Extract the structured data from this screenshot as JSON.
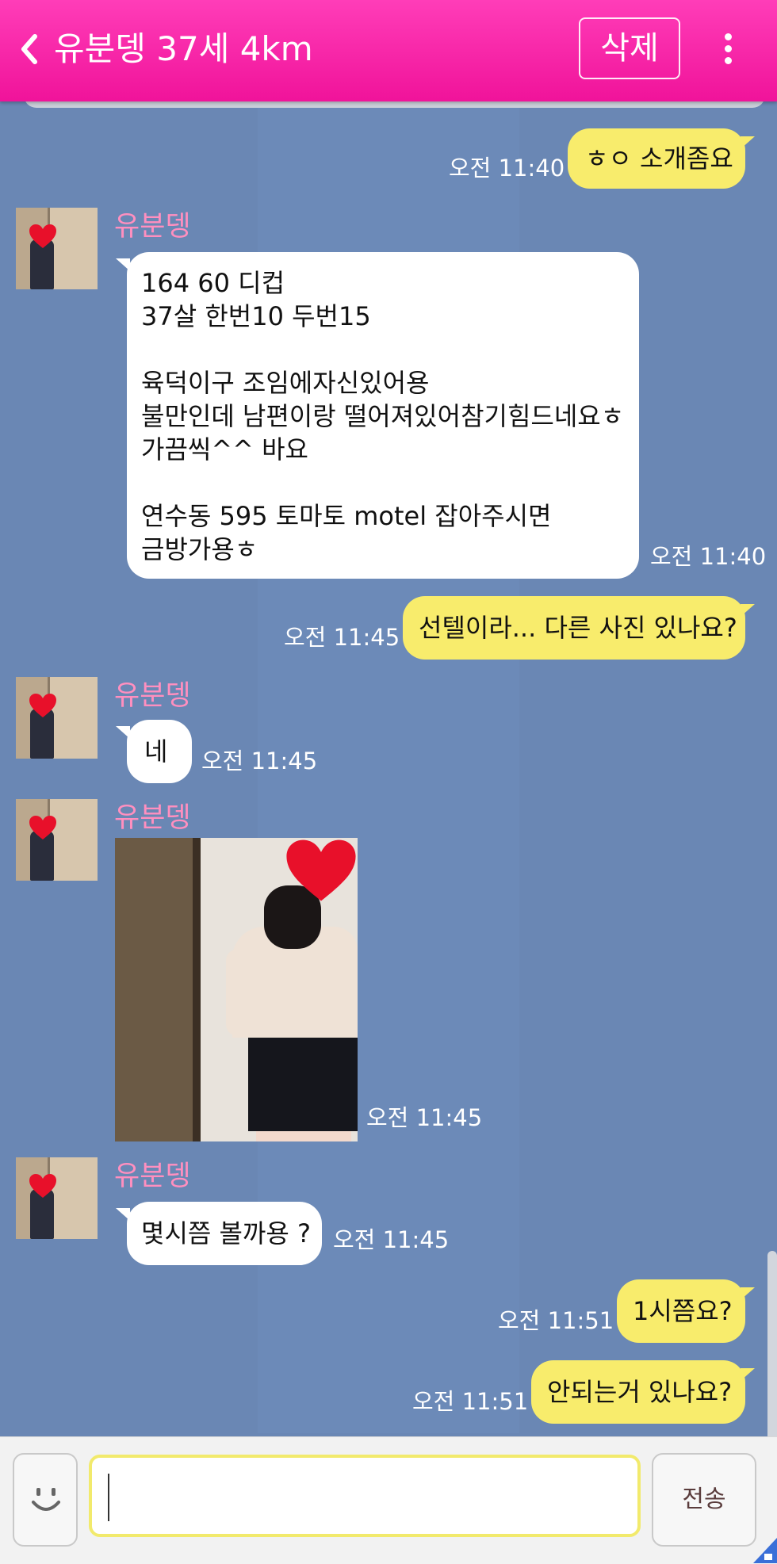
{
  "header": {
    "back_icon": "chevron-left-icon",
    "title": "유분뎅 37세 4km",
    "delete_label": "삭제",
    "more_icon": "vertical-dots-icon",
    "bg_color": "#f0139a"
  },
  "colors": {
    "chat_bg": "#6a87b4",
    "my_bubble": "#f8ec6c",
    "their_bubble": "#ffffff",
    "sender_name": "#ff8fbf"
  },
  "messages": [
    {
      "from": "me",
      "time": "오전 11:40",
      "lines": [
        "ㅎㅇ 소개좀요"
      ]
    },
    {
      "from": "them",
      "sender": "유분뎅",
      "time": "오전 11:40",
      "lines": [
        "164 60 디컵",
        "37살 한번10 두번15",
        "",
        "육덕이구 조임에자신있어용",
        "불만인데 남편이랑 떨어져있어참기힘드네요ㅎ",
        "가끔씩^^ 바요",
        "",
        "연수동 595 토마토 motel 잡아주시면",
        "금방가용ㅎ"
      ]
    },
    {
      "from": "me",
      "time": "오전 11:45",
      "lines": [
        "선텔이라... 다른 사진 있나요?"
      ]
    },
    {
      "from": "them",
      "sender": "유분뎅",
      "time": "오전 11:45",
      "lines": [
        "네"
      ]
    },
    {
      "from": "them",
      "sender": "유분뎅",
      "time": "오전 11:45",
      "type": "photo"
    },
    {
      "from": "them",
      "sender": "유분뎅",
      "time": "오전 11:45",
      "lines": [
        "몇시쯤 볼까용 ?"
      ]
    },
    {
      "from": "me",
      "time": "오전 11:51",
      "lines": [
        "1시쯤요?"
      ]
    },
    {
      "from": "me",
      "time": "오전 11:51",
      "lines": [
        "안되는거 있나요?"
      ]
    }
  ],
  "composer": {
    "emoji_icon": "smiley-icon",
    "input_value": "",
    "send_label": "전송"
  }
}
